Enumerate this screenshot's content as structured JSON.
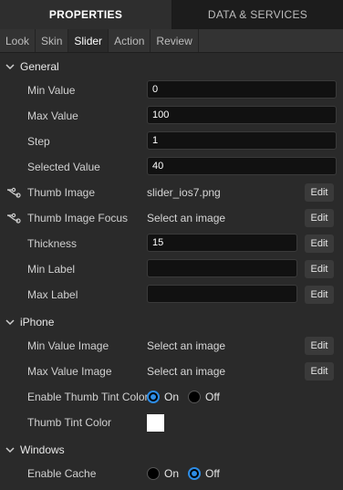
{
  "top_tabs": {
    "properties": "PROPERTIES",
    "data_services": "DATA & SERVICES"
  },
  "sub_tabs": [
    "Look",
    "Skin",
    "Slider",
    "Action",
    "Review"
  ],
  "edit_label": "Edit",
  "general": {
    "title": "General",
    "min_value": {
      "label": "Min Value",
      "value": "0"
    },
    "max_value": {
      "label": "Max Value",
      "value": "100"
    },
    "step": {
      "label": "Step",
      "value": "1"
    },
    "selected_value": {
      "label": "Selected Value",
      "value": "40"
    },
    "thumb_image": {
      "label": "Thumb Image",
      "value": "slider_ios7.png"
    },
    "thumb_image_focus": {
      "label": "Thumb Image Focus",
      "value": "Select an image"
    },
    "thickness": {
      "label": "Thickness",
      "value": "15"
    },
    "min_label": {
      "label": "Min Label",
      "value": ""
    },
    "max_label": {
      "label": "Max Label",
      "value": ""
    }
  },
  "iphone": {
    "title": "iPhone",
    "min_value_image": {
      "label": "Min Value Image",
      "value": "Select an image"
    },
    "max_value_image": {
      "label": "Max Value Image",
      "value": "Select an image"
    },
    "enable_thumb_tint": {
      "label": "Enable Thumb Tint Color",
      "on": "On",
      "off": "Off",
      "selected": "On"
    },
    "thumb_tint_color": {
      "label": "Thumb Tint Color",
      "color": "#ffffff"
    }
  },
  "windows": {
    "title": "Windows",
    "enable_cache": {
      "label": "Enable Cache",
      "on": "On",
      "off": "Off",
      "selected": "Off"
    }
  },
  "colors": {
    "accent": "#2d8ce5",
    "background": "#2a2a2a"
  }
}
